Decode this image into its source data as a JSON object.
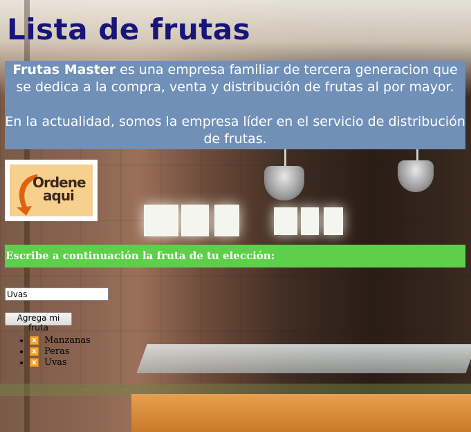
{
  "page": {
    "title": "Lista de frutas"
  },
  "intro": {
    "company_name": "Frutas Master",
    "paragraph1_rest": " es una empresa familiar de tercera generacion que se dedica a la compra, venta y distribución de frutas al por mayor.",
    "paragraph2": "En la actualidad, somos la empresa líder en el servicio de distribución de frutas."
  },
  "logo": {
    "line1": "Ordene",
    "line2": "aqui"
  },
  "form": {
    "prompt": "Escribe a continuación la fruta de tu elección:",
    "input_value": "Uvas",
    "button_label": "Agrega mi fruta"
  },
  "fruits": [
    {
      "name": "Manzanas",
      "remove_icon": "x-icon"
    },
    {
      "name": "Peras",
      "remove_icon": "x-icon"
    },
    {
      "name": "Uvas",
      "remove_icon": "x-icon"
    }
  ],
  "colors": {
    "title": "#17157a",
    "intro_bg": "#7090b8",
    "prompt_bg": "#5ecf4a",
    "remove_icon": "#f0a83a"
  }
}
